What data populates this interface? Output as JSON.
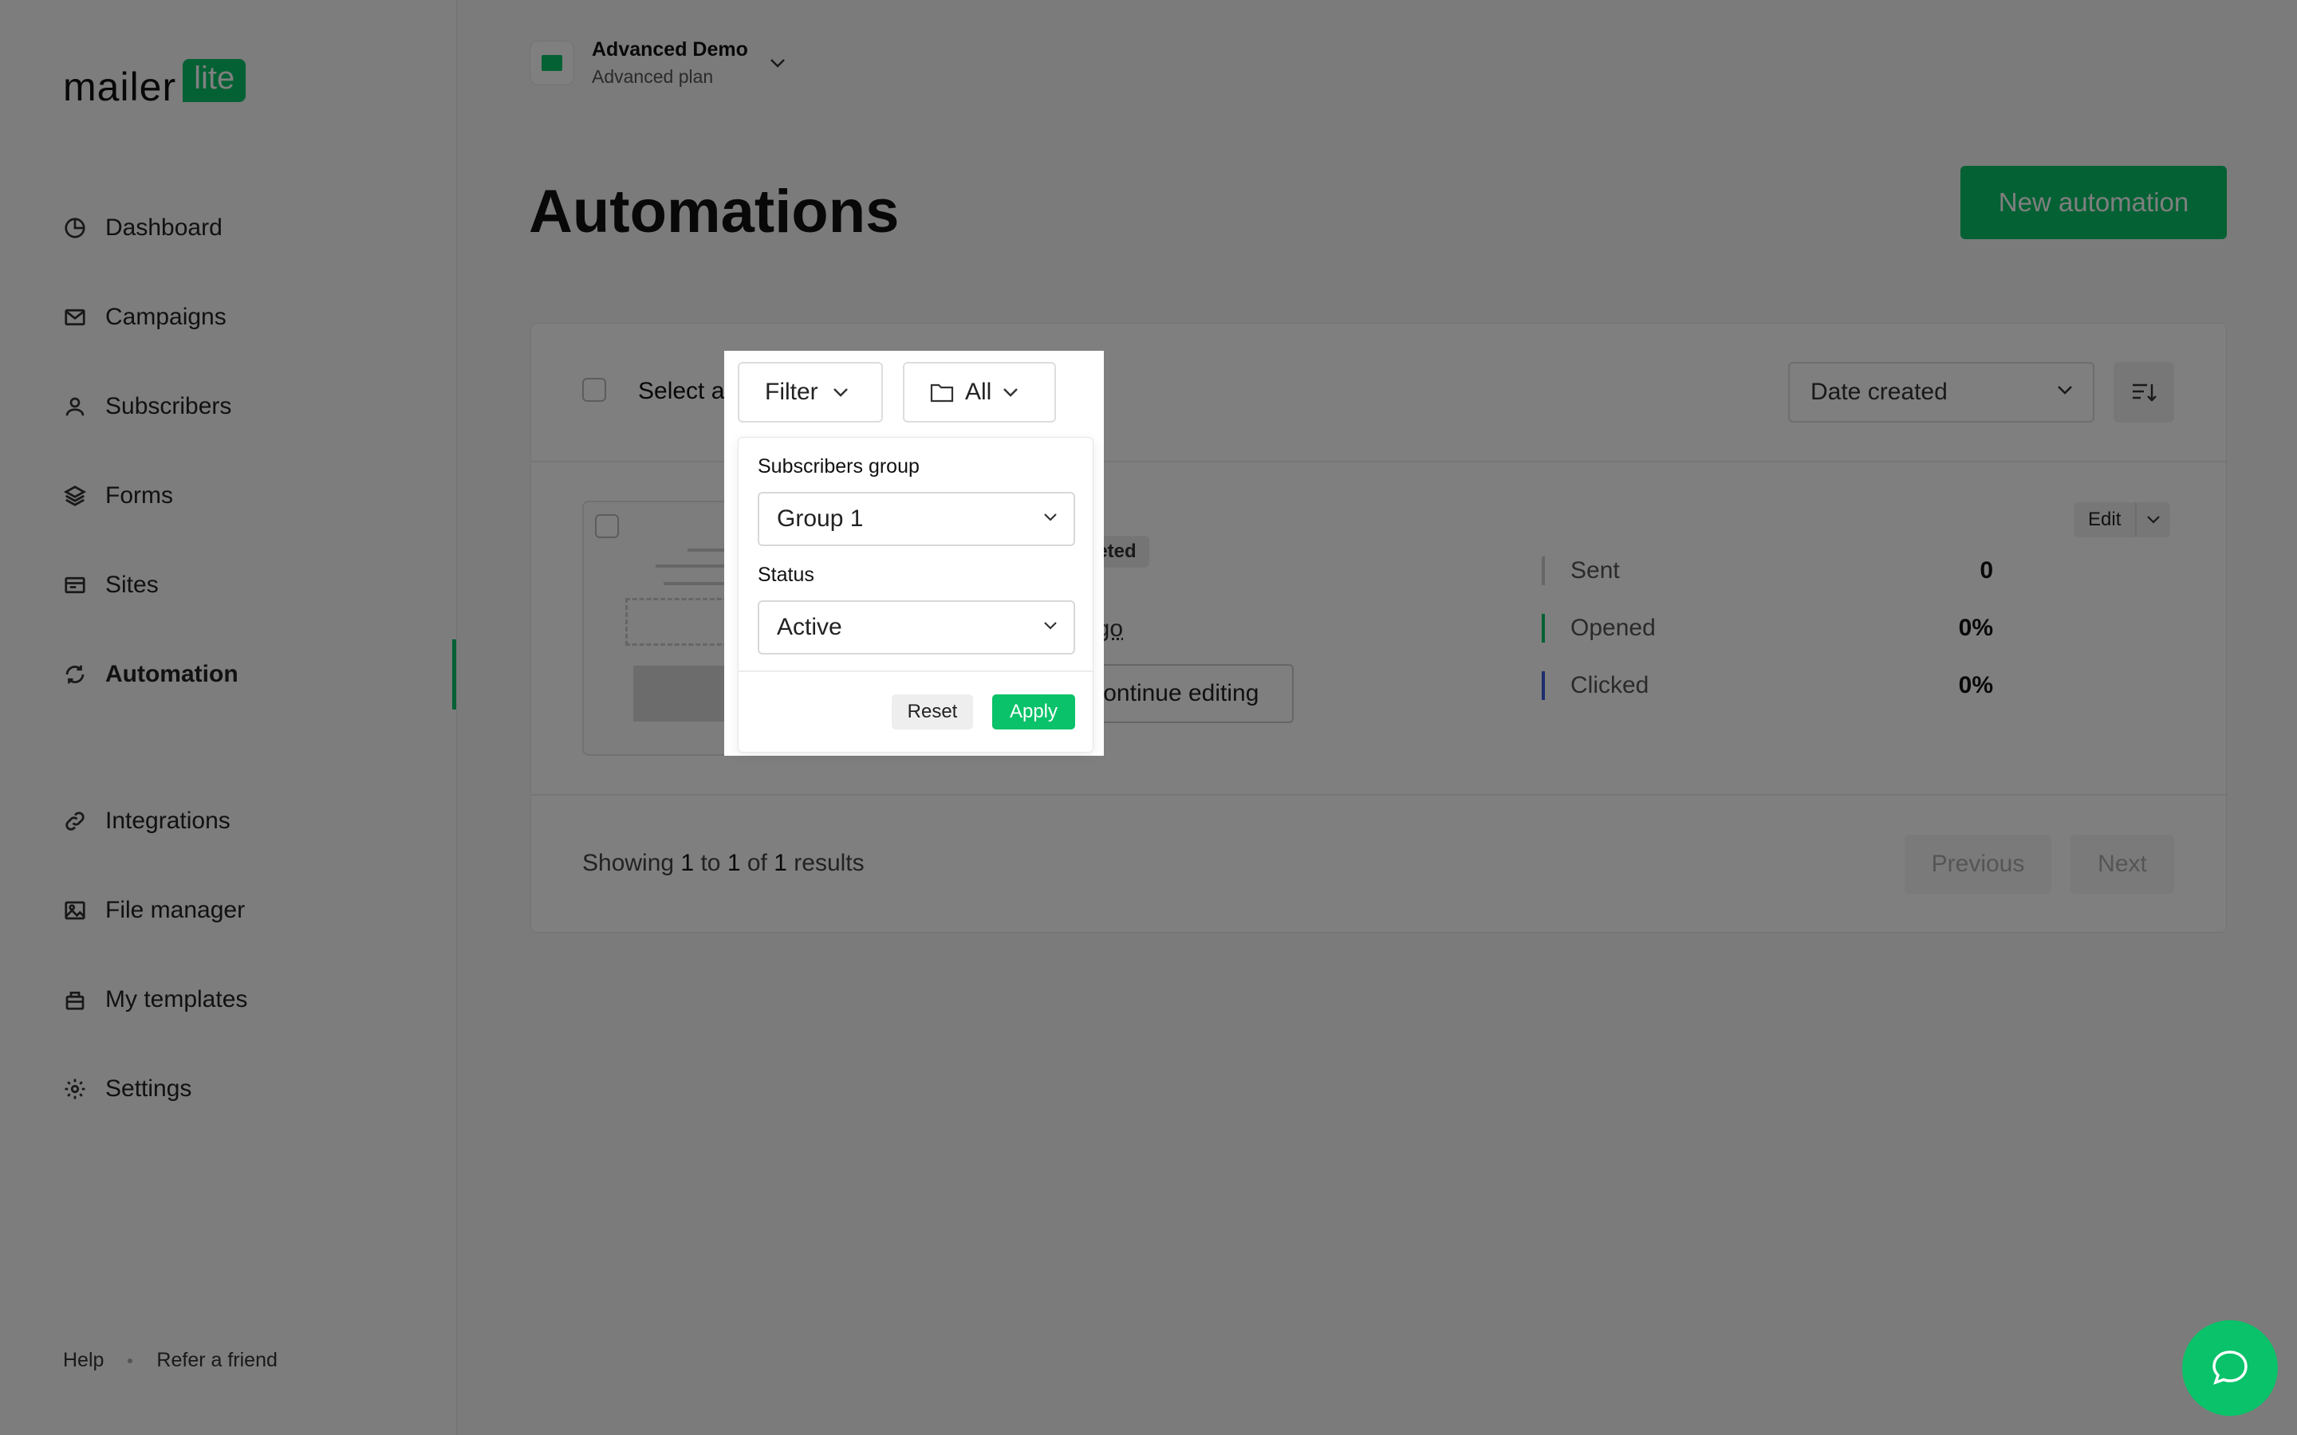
{
  "brand": {
    "word": "mailer",
    "badge": "lite",
    "accent": "#09c269"
  },
  "sidebar": {
    "items": [
      {
        "label": "Dashboard",
        "icon": "dashboard-icon"
      },
      {
        "label": "Campaigns",
        "icon": "mail-icon"
      },
      {
        "label": "Subscribers",
        "icon": "user-icon"
      },
      {
        "label": "Forms",
        "icon": "layers-icon"
      },
      {
        "label": "Sites",
        "icon": "browser-icon"
      },
      {
        "label": "Automation",
        "icon": "refresh-icon",
        "active": true
      },
      {
        "label": "Integrations",
        "icon": "link-icon"
      },
      {
        "label": "File manager",
        "icon": "image-icon"
      },
      {
        "label": "My templates",
        "icon": "template-icon"
      },
      {
        "label": "Settings",
        "icon": "gear-icon"
      }
    ],
    "footer": {
      "help": "Help",
      "refer": "Refer a friend"
    }
  },
  "account": {
    "name": "Advanced Demo",
    "plan": "Advanced plan"
  },
  "page": {
    "title": "Automations",
    "new_button": "New automation"
  },
  "toolbar": {
    "select_all": "Select all",
    "filter": "Filter",
    "folder": "All",
    "sort": "Date created"
  },
  "automation": {
    "status_partial": "pleted",
    "ago_partial": "ago",
    "continue_label": "Continue editing",
    "edit_label": "Edit",
    "stats": [
      {
        "label": "Sent",
        "value": "0",
        "color": "#cccccc"
      },
      {
        "label": "Opened",
        "value": "0%",
        "color": "#09c269"
      },
      {
        "label": "Clicked",
        "value": "0%",
        "color": "#3b5bdb"
      }
    ]
  },
  "pagination": {
    "showing": "Showing",
    "from": "1",
    "to_word": "to",
    "to": "1",
    "of_word": "of",
    "total": "1",
    "results": "results",
    "previous": "Previous",
    "next": "Next"
  },
  "filter_panel": {
    "group_label": "Subscribers group",
    "group_value": "Group 1",
    "status_label": "Status",
    "status_value": "Active",
    "reset": "Reset",
    "apply": "Apply"
  }
}
